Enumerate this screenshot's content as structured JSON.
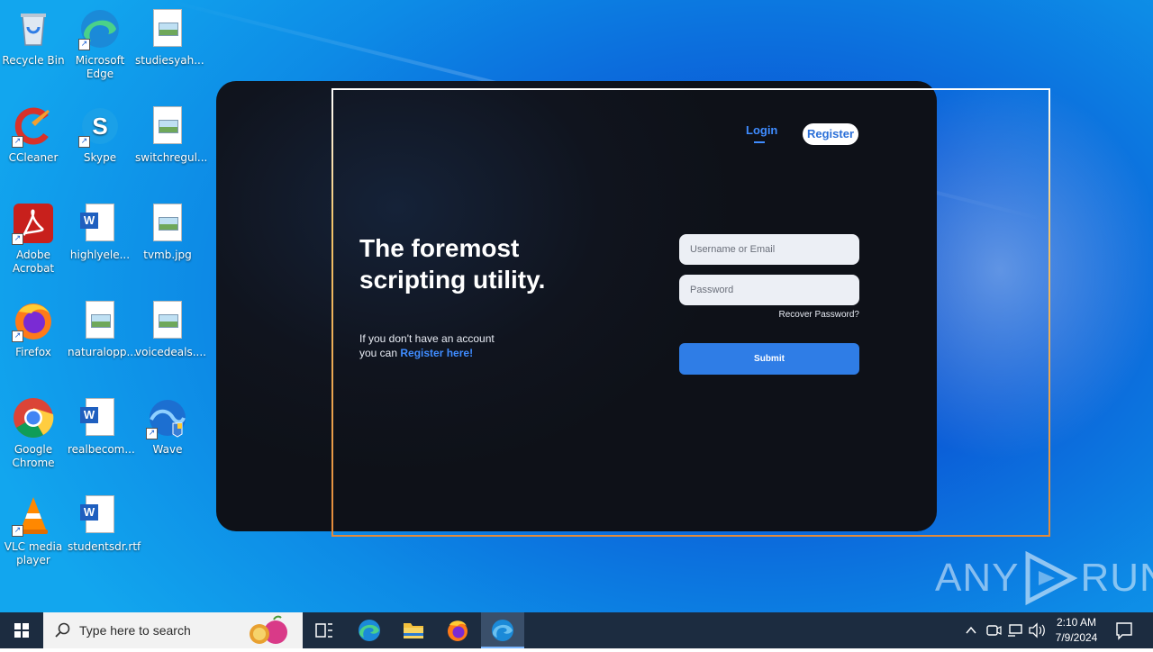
{
  "desktop": {
    "icons": [
      {
        "label": "Recycle Bin",
        "icon": "recycle-bin-icon"
      },
      {
        "label": "Microsoft Edge",
        "icon": "edge-icon"
      },
      {
        "label": "studiesyah...",
        "icon": "image-file-icon"
      },
      {
        "label": "CCleaner",
        "icon": "ccleaner-icon"
      },
      {
        "label": "Skype",
        "icon": "skype-icon"
      },
      {
        "label": "switchregul...",
        "icon": "image-file-icon"
      },
      {
        "label": "Adobe Acrobat",
        "icon": "acrobat-icon"
      },
      {
        "label": "highlyele...",
        "icon": "word-file-icon"
      },
      {
        "label": "tvmb.jpg",
        "icon": "image-file-icon"
      },
      {
        "label": "Firefox",
        "icon": "firefox-icon"
      },
      {
        "label": "naturalopp...",
        "icon": "image-file-icon"
      },
      {
        "label": "voicedeals....",
        "icon": "image-file-icon"
      },
      {
        "label": "Google Chrome",
        "icon": "chrome-icon"
      },
      {
        "label": "realbecom...",
        "icon": "word-file-icon"
      },
      {
        "label": "Wave",
        "icon": "wave-browser-icon"
      },
      {
        "label": "VLC media player",
        "icon": "vlc-icon"
      },
      {
        "label": "studentsdr.rtf",
        "icon": "word-file-icon"
      }
    ]
  },
  "app": {
    "nav": {
      "login": "Login",
      "register": "Register"
    },
    "headline": "The foremost scripting utility.",
    "subtext_line1": "If you don't have an account",
    "subtext_line2_prefix": "you can ",
    "subtext_link": "Register here!",
    "username_placeholder": "Username or Email",
    "password_placeholder": "Password",
    "recover": "Recover Password?",
    "submit": "Submit",
    "colors": {
      "accent": "#2f7de6",
      "link": "#3f8cff",
      "bg": "#10141e"
    }
  },
  "watermark": {
    "left": "ANY",
    "right": "RUN"
  },
  "taskbar": {
    "search_placeholder": "Type here to search",
    "time": "2:10 AM",
    "date": "7/9/2024"
  }
}
